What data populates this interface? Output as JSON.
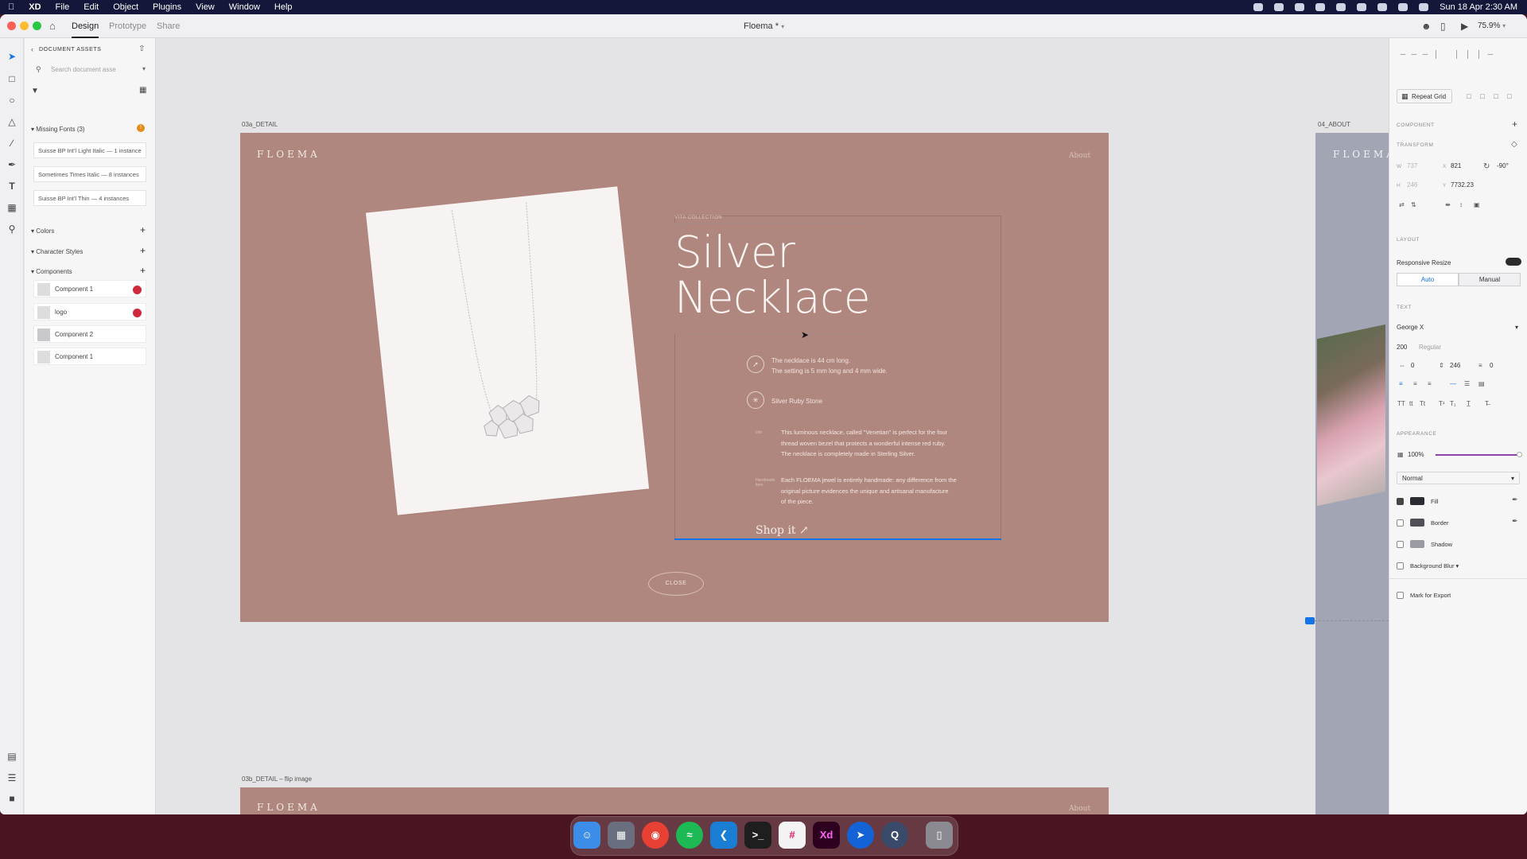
{
  "menubar": {
    "apple": "",
    "app_name": "XD",
    "menus": [
      "File",
      "Edit",
      "Object",
      "Plugins",
      "View",
      "Window",
      "Help"
    ],
    "clock": "Sun 18 Apr  2:30 AM"
  },
  "titlebar": {
    "tabs": [
      "Design",
      "Prototype",
      "Share"
    ],
    "active_tab": "Design",
    "document_title": "Floema *",
    "zoom": "75.9%"
  },
  "assets": {
    "header": "DOCUMENT ASSETS",
    "search_placeholder": "Search document asse",
    "missing_fonts_label": "Missing Fonts (3)",
    "missing_fonts_badge": "!",
    "missing_fonts": [
      "Suisse BP Int'l Light Italic — 1 instance",
      "Sometimes Times Italic — 8 instances",
      "Suisse BP Int'l Thin — 4 instances"
    ],
    "colors_label": "Colors",
    "character_styles_label": "Character Styles",
    "components_label": "Components",
    "components": [
      "Component 1",
      "logo",
      "Component 2",
      "Component 1"
    ]
  },
  "canvas": {
    "artboard1_label": "03a_DETAIL",
    "artboard2_label": "03b_DETAIL – flip image",
    "artboard3_label": "04_ABOUT",
    "logo": "FLOEMA",
    "about": "About",
    "collection": "VITA COLLECTION",
    "title_line1": "Silver",
    "title_line2": "Necklace",
    "spec1_line1": "The necklace is 44 cm long.",
    "spec1_line2": "The setting is 5 mm long and 4 mm wide.",
    "spec2": "Silver Ruby Stone",
    "side_label1": "Info",
    "side_label2": "Handmade item",
    "para1_line1": "This luminous necklace, called \"Venetian\" is perfect for the four",
    "para1_line2": "thread woven bezel that protects a wonderful intense red ruby.",
    "para1_line3": "The necklace is completely made in Sterling Silver.",
    "para2_line1": "Each FLOEMA jewel is entirely handmade: any difference from the",
    "para2_line2": "original picture evidences the unique and artisanal manufacture",
    "para2_line3": "of the piece.",
    "shop": "Shop it ↗",
    "close": "CLOSE"
  },
  "inspector": {
    "repeat_grid": "Repeat Grid",
    "component_label": "COMPONENT",
    "transform_label": "TRANSFORM",
    "w_label": "W",
    "w_value": "737",
    "h_label": "H",
    "h_value": "246",
    "x_label": "X",
    "x_value": "821",
    "y_label": "Y",
    "y_value": "7732.23",
    "rotation": "-90°",
    "layout_label": "LAYOUT",
    "responsive_resize": "Responsive Resize",
    "auto": "Auto",
    "manual": "Manual",
    "text_label": "TEXT",
    "font_family": "George X",
    "font_size": "200",
    "font_style": "Regular",
    "char_spacing": "0",
    "line_spacing": "246",
    "para_spacing": "0",
    "appearance_label": "APPEARANCE",
    "opacity": "100%",
    "blend_mode": "Normal",
    "fill": "Fill",
    "border": "Border",
    "shadow": "Shadow",
    "background_blur": "Background Blur",
    "mark_for_export": "Mark for Export"
  },
  "colors": {
    "accent": "#1473e6",
    "artboard": "#b0877e",
    "missing_badge": "#e68a1a",
    "component_badge": "#d0293b"
  },
  "dock": {
    "apps": [
      "finder-icon",
      "launchpad-icon",
      "chrome-icon",
      "spotify-icon",
      "vscode-icon",
      "terminal-icon",
      "slack-icon",
      "xd-icon",
      "maps-icon",
      "quicktime-icon",
      "trash-icon"
    ],
    "xd_label": "Xd"
  }
}
